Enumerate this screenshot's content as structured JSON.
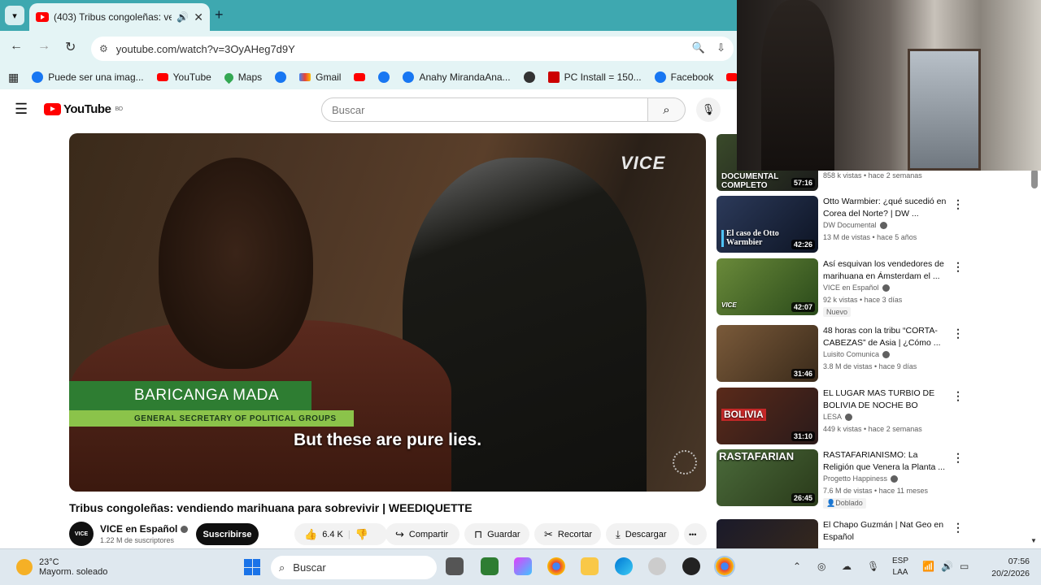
{
  "browser": {
    "tab_title": "(403) Tribus congoleñas: ven",
    "new_tab_label": "+",
    "url": "youtube.com/watch?v=3OyAHeg7d9Y",
    "bookmarks": [
      {
        "label": "Puede ser una imag...",
        "icon": "facebook-icon"
      },
      {
        "label": "YouTube",
        "icon": "youtube-icon"
      },
      {
        "label": "Maps",
        "icon": "maps-icon"
      },
      {
        "label": "",
        "icon": "facebook-icon"
      },
      {
        "label": "Gmail",
        "icon": "gmail-icon"
      },
      {
        "label": "",
        "icon": "youtube-icon"
      },
      {
        "label": "",
        "icon": "facebook-icon"
      },
      {
        "label": "Anahy MirandaAna...",
        "icon": "facebook-icon"
      },
      {
        "label": "",
        "icon": "globe-icon"
      },
      {
        "label": "PC Install = 150...",
        "icon": "bookmark-icon"
      },
      {
        "label": "Facebook",
        "icon": "facebook-icon"
      },
      {
        "label": "",
        "icon": "youtube-icon"
      }
    ]
  },
  "youtube": {
    "logo_text": "YouTube",
    "logo_country": "BO",
    "search_placeholder": "Buscar"
  },
  "video": {
    "watermark": "VICE",
    "lower_third_name": "BARICANGA MADA",
    "lower_third_role": "GENERAL SECRETARY OF POLITICAL GROUPS",
    "subtitle": "But these are pure lies.",
    "title": "Tribus congoleñas: vendiendo marihuana para sobrevivir | WEEDIQUETTE",
    "channel_name": "VICE en Español",
    "channel_subs": "1.22 M de suscriptores",
    "channel_avatar_text": "VICE",
    "subscribe_label": "Suscribirse",
    "likes": "6.4 K",
    "share_label": "Compartir",
    "save_label": "Guardar",
    "clip_label": "Recortar",
    "download_label": "Descargar",
    "more_label": "•••"
  },
  "recommendations": [
    {
      "thumb_text": "DOCUMENTAL COMPLETO",
      "duration": "57:16",
      "title": "",
      "channel": "",
      "meta": "858 k vistas • hace 2 semanas",
      "badge": ""
    },
    {
      "thumb_text": "El caso de Otto Warmbier",
      "duration": "42:26",
      "title": "Otto Warmbier: ¿qué sucedió en Corea del Norte? | DW ...",
      "channel": "DW Documental",
      "meta": "13 M de vistas • hace 5 años",
      "badge": ""
    },
    {
      "thumb_text": "VICE",
      "duration": "42:07",
      "title": "Así esquivan los vendedores de marihuana en Ámsterdam el ...",
      "channel": "VICE en Español",
      "meta": "92 k vistas • hace 3 días",
      "badge": "Nuevo"
    },
    {
      "thumb_text": "",
      "duration": "31:46",
      "title": "48 horas con la tribu “CORTA-CABEZAS” de Asia | ¿Cómo ...",
      "channel": "Luisito Comunica",
      "meta": "3.8 M de vistas • hace 9 días",
      "badge": ""
    },
    {
      "thumb_text": "BOLIVIA",
      "duration": "31:10",
      "title": "EL LUGAR MAS TURBIO DE BOLIVIA DE NOCHE BO",
      "channel": "LESA",
      "meta": "449 k vistas • hace 2 semanas",
      "badge": ""
    },
    {
      "thumb_text": "RASTAFARIAN",
      "duration": "26:45",
      "title": "RASTAFARIANISMO: La Religión que Venera la Planta ...",
      "channel": "Progetto Happiness",
      "meta": "7.6 M de vistas • hace 11 meses",
      "badge": "Doblado"
    },
    {
      "thumb_text": "",
      "duration": "",
      "title": "El Chapo Guzmán | Nat Geo en Español",
      "channel": "",
      "meta": "",
      "badge": ""
    }
  ],
  "taskbar": {
    "weather_temp": "23°C",
    "weather_desc": "Mayorm. soleado",
    "search_label": "Buscar",
    "lang_top": "ESP",
    "lang_bottom": "LAA",
    "time": "07:56",
    "date": "20/2/2026"
  }
}
